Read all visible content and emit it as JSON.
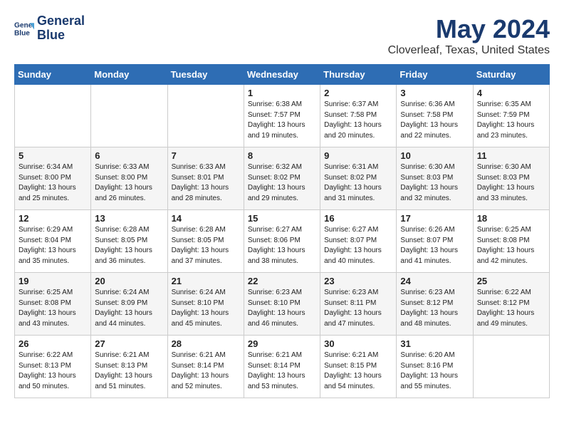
{
  "header": {
    "logo_line1": "General",
    "logo_line2": "Blue",
    "title": "May 2024",
    "location": "Cloverleaf, Texas, United States"
  },
  "weekdays": [
    "Sunday",
    "Monday",
    "Tuesday",
    "Wednesday",
    "Thursday",
    "Friday",
    "Saturday"
  ],
  "weeks": [
    [
      {
        "day": "",
        "info": ""
      },
      {
        "day": "",
        "info": ""
      },
      {
        "day": "",
        "info": ""
      },
      {
        "day": "1",
        "info": "Sunrise: 6:38 AM\nSunset: 7:57 PM\nDaylight: 13 hours\nand 19 minutes."
      },
      {
        "day": "2",
        "info": "Sunrise: 6:37 AM\nSunset: 7:58 PM\nDaylight: 13 hours\nand 20 minutes."
      },
      {
        "day": "3",
        "info": "Sunrise: 6:36 AM\nSunset: 7:58 PM\nDaylight: 13 hours\nand 22 minutes."
      },
      {
        "day": "4",
        "info": "Sunrise: 6:35 AM\nSunset: 7:59 PM\nDaylight: 13 hours\nand 23 minutes."
      }
    ],
    [
      {
        "day": "5",
        "info": "Sunrise: 6:34 AM\nSunset: 8:00 PM\nDaylight: 13 hours\nand 25 minutes."
      },
      {
        "day": "6",
        "info": "Sunrise: 6:33 AM\nSunset: 8:00 PM\nDaylight: 13 hours\nand 26 minutes."
      },
      {
        "day": "7",
        "info": "Sunrise: 6:33 AM\nSunset: 8:01 PM\nDaylight: 13 hours\nand 28 minutes."
      },
      {
        "day": "8",
        "info": "Sunrise: 6:32 AM\nSunset: 8:02 PM\nDaylight: 13 hours\nand 29 minutes."
      },
      {
        "day": "9",
        "info": "Sunrise: 6:31 AM\nSunset: 8:02 PM\nDaylight: 13 hours\nand 31 minutes."
      },
      {
        "day": "10",
        "info": "Sunrise: 6:30 AM\nSunset: 8:03 PM\nDaylight: 13 hours\nand 32 minutes."
      },
      {
        "day": "11",
        "info": "Sunrise: 6:30 AM\nSunset: 8:03 PM\nDaylight: 13 hours\nand 33 minutes."
      }
    ],
    [
      {
        "day": "12",
        "info": "Sunrise: 6:29 AM\nSunset: 8:04 PM\nDaylight: 13 hours\nand 35 minutes."
      },
      {
        "day": "13",
        "info": "Sunrise: 6:28 AM\nSunset: 8:05 PM\nDaylight: 13 hours\nand 36 minutes."
      },
      {
        "day": "14",
        "info": "Sunrise: 6:28 AM\nSunset: 8:05 PM\nDaylight: 13 hours\nand 37 minutes."
      },
      {
        "day": "15",
        "info": "Sunrise: 6:27 AM\nSunset: 8:06 PM\nDaylight: 13 hours\nand 38 minutes."
      },
      {
        "day": "16",
        "info": "Sunrise: 6:27 AM\nSunset: 8:07 PM\nDaylight: 13 hours\nand 40 minutes."
      },
      {
        "day": "17",
        "info": "Sunrise: 6:26 AM\nSunset: 8:07 PM\nDaylight: 13 hours\nand 41 minutes."
      },
      {
        "day": "18",
        "info": "Sunrise: 6:25 AM\nSunset: 8:08 PM\nDaylight: 13 hours\nand 42 minutes."
      }
    ],
    [
      {
        "day": "19",
        "info": "Sunrise: 6:25 AM\nSunset: 8:08 PM\nDaylight: 13 hours\nand 43 minutes."
      },
      {
        "day": "20",
        "info": "Sunrise: 6:24 AM\nSunset: 8:09 PM\nDaylight: 13 hours\nand 44 minutes."
      },
      {
        "day": "21",
        "info": "Sunrise: 6:24 AM\nSunset: 8:10 PM\nDaylight: 13 hours\nand 45 minutes."
      },
      {
        "day": "22",
        "info": "Sunrise: 6:23 AM\nSunset: 8:10 PM\nDaylight: 13 hours\nand 46 minutes."
      },
      {
        "day": "23",
        "info": "Sunrise: 6:23 AM\nSunset: 8:11 PM\nDaylight: 13 hours\nand 47 minutes."
      },
      {
        "day": "24",
        "info": "Sunrise: 6:23 AM\nSunset: 8:12 PM\nDaylight: 13 hours\nand 48 minutes."
      },
      {
        "day": "25",
        "info": "Sunrise: 6:22 AM\nSunset: 8:12 PM\nDaylight: 13 hours\nand 49 minutes."
      }
    ],
    [
      {
        "day": "26",
        "info": "Sunrise: 6:22 AM\nSunset: 8:13 PM\nDaylight: 13 hours\nand 50 minutes."
      },
      {
        "day": "27",
        "info": "Sunrise: 6:21 AM\nSunset: 8:13 PM\nDaylight: 13 hours\nand 51 minutes."
      },
      {
        "day": "28",
        "info": "Sunrise: 6:21 AM\nSunset: 8:14 PM\nDaylight: 13 hours\nand 52 minutes."
      },
      {
        "day": "29",
        "info": "Sunrise: 6:21 AM\nSunset: 8:14 PM\nDaylight: 13 hours\nand 53 minutes."
      },
      {
        "day": "30",
        "info": "Sunrise: 6:21 AM\nSunset: 8:15 PM\nDaylight: 13 hours\nand 54 minutes."
      },
      {
        "day": "31",
        "info": "Sunrise: 6:20 AM\nSunset: 8:16 PM\nDaylight: 13 hours\nand 55 minutes."
      },
      {
        "day": "",
        "info": ""
      }
    ]
  ]
}
